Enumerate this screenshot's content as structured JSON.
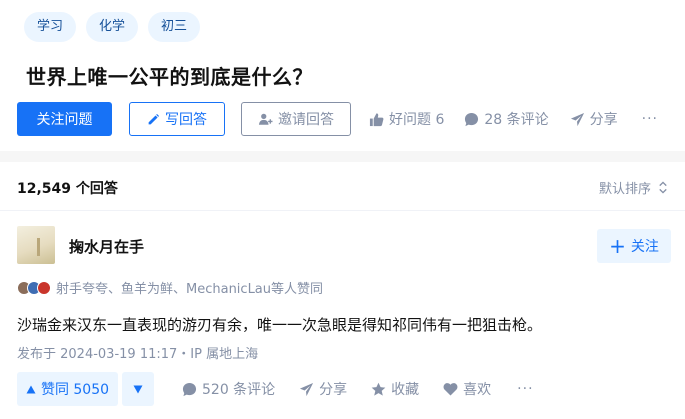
{
  "topics": [
    "学习",
    "化学",
    "初三"
  ],
  "question": {
    "title": "世界上唯一公平的到底是什么？",
    "follow_label": "关注问题",
    "write_label": "写回答",
    "invite_label": "邀请回答",
    "good_question_label": "好问题 6",
    "comments_label": "28 条评论",
    "share_label": "分享",
    "more_label": "···"
  },
  "answers": {
    "count_label": "12,549 个回答",
    "sort_label": "默认排序"
  },
  "answer": {
    "author": "掬水月在手",
    "follow_label": "关注",
    "follow_icon": "plus-icon",
    "voters_text": "射手夸夸、鱼羊为鲜、MechanicLau等人赞同",
    "content": "沙瑞金来汉东一直表现的游刃有余，唯一一次急眼是得知祁同伟有一把狙击枪。",
    "time": "发布于 2024-03-19 11:17・IP 属地上海",
    "vote_label": "赞同 5050",
    "comments_label": "520 条评论",
    "share_label": "分享",
    "collect_label": "收藏",
    "like_label": "喜欢",
    "more_label": "···"
  },
  "colors": {
    "primary": "#1772f6",
    "primary_light": "#ebf5ff",
    "topic_text": "#175199",
    "meta_gray": "#8590a6",
    "text": "#121212",
    "page_bg": "#f6f6f6"
  }
}
